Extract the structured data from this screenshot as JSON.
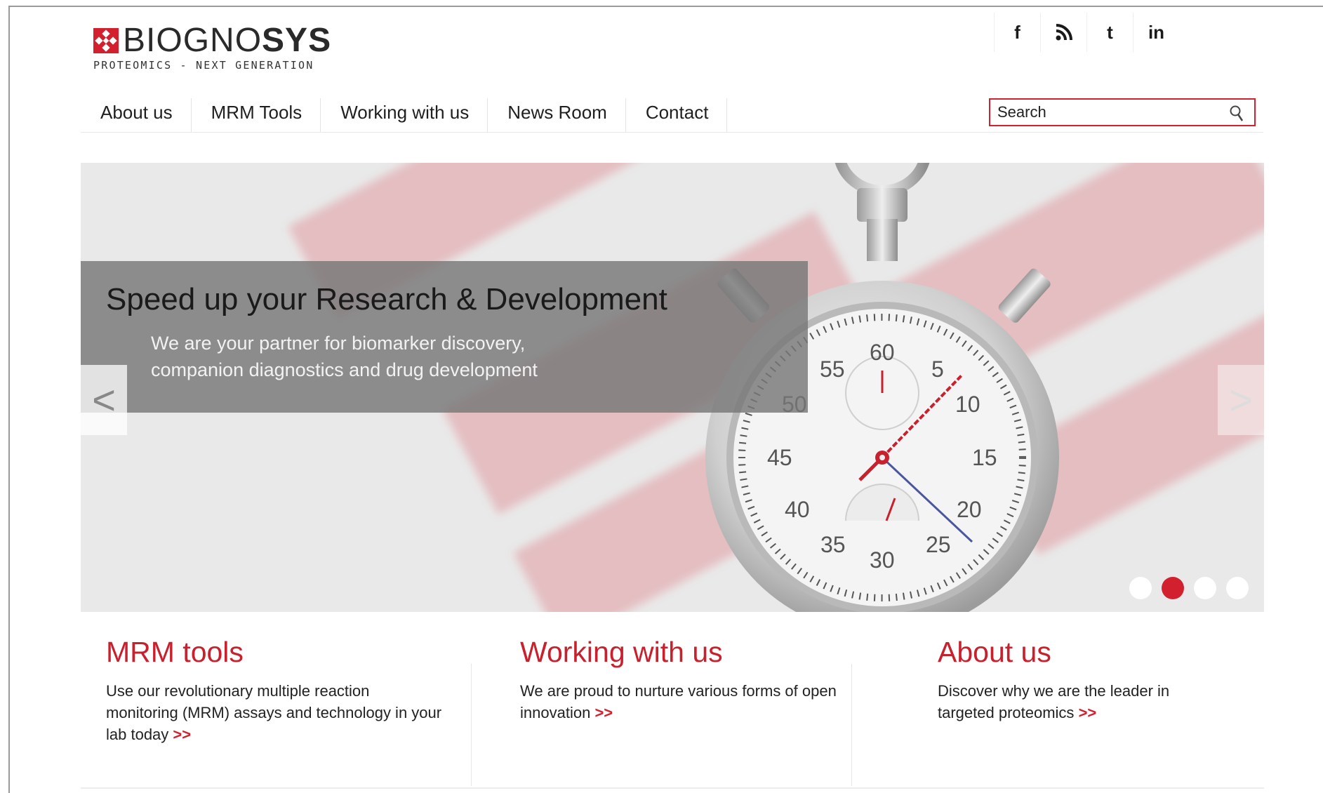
{
  "brand": {
    "name_light": "BIOGNO",
    "name_bold": "SYS",
    "tagline": "PROTEOMICS - NEXT GENERATION",
    "accent_color": "#d3202e"
  },
  "social": [
    {
      "icon": "facebook-icon",
      "glyph": "f"
    },
    {
      "icon": "rss-icon",
      "glyph": "≈"
    },
    {
      "icon": "twitter-icon",
      "glyph": "t"
    },
    {
      "icon": "linkedin-icon",
      "glyph": "in"
    }
  ],
  "nav": {
    "items": [
      "About us",
      "MRM Tools",
      "Working with us",
      "News Room",
      "Contact"
    ]
  },
  "search": {
    "placeholder": "Search"
  },
  "hero": {
    "title": "Speed up your Research & Development",
    "subtitle_line1": "We are your partner for biomarker discovery,",
    "subtitle_line2": "companion diagnostics and drug development",
    "prev_arrow": "<",
    "next_arrow": ">",
    "slides_total": 4,
    "active_slide": 2,
    "dial_numbers": [
      "60",
      "5",
      "10",
      "15",
      "20",
      "25",
      "30",
      "35",
      "40",
      "45",
      "50",
      "55"
    ]
  },
  "columns": [
    {
      "title": "MRM tools",
      "text": "Use our revolutionary multiple reaction monitoring (MRM) assays and technology in your lab today",
      "more": ">>"
    },
    {
      "title": "Working with us",
      "text": "We are proud to nurture various forms of open innovation",
      "more": ">>"
    },
    {
      "title": "About us",
      "text": "Discover why we are the leader in targeted proteomics",
      "more": ">>"
    }
  ]
}
